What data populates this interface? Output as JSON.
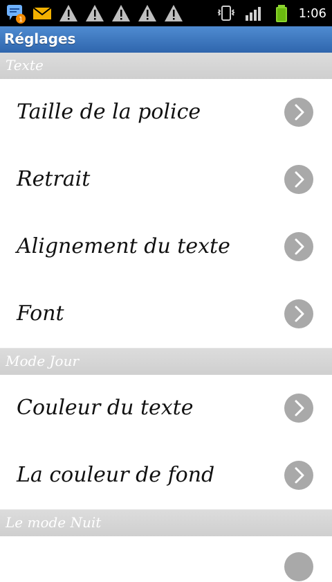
{
  "status_bar": {
    "time": "1:06",
    "notification_badge": "1",
    "left_icons": [
      "chat-notification-icon",
      "email-icon",
      "warning-icon",
      "warning-icon",
      "warning-icon",
      "warning-icon",
      "warning-icon"
    ],
    "right_icons": [
      "vibrate-icon",
      "signal-icon",
      "battery-icon"
    ]
  },
  "header": {
    "title": "Réglages"
  },
  "sections": [
    {
      "title": "Texte",
      "items": [
        "Taille de la police",
        "Retrait",
        "Alignement du texte",
        "Font"
      ]
    },
    {
      "title": "Mode Jour",
      "items": [
        "Couleur du texte",
        "La couleur de fond"
      ]
    },
    {
      "title": "Le mode Nuit",
      "items": []
    }
  ],
  "colors": {
    "title_bar": "#3a75bf",
    "section_bg": "#d4d4d4",
    "chevron_bg": "#a9a9a9"
  }
}
